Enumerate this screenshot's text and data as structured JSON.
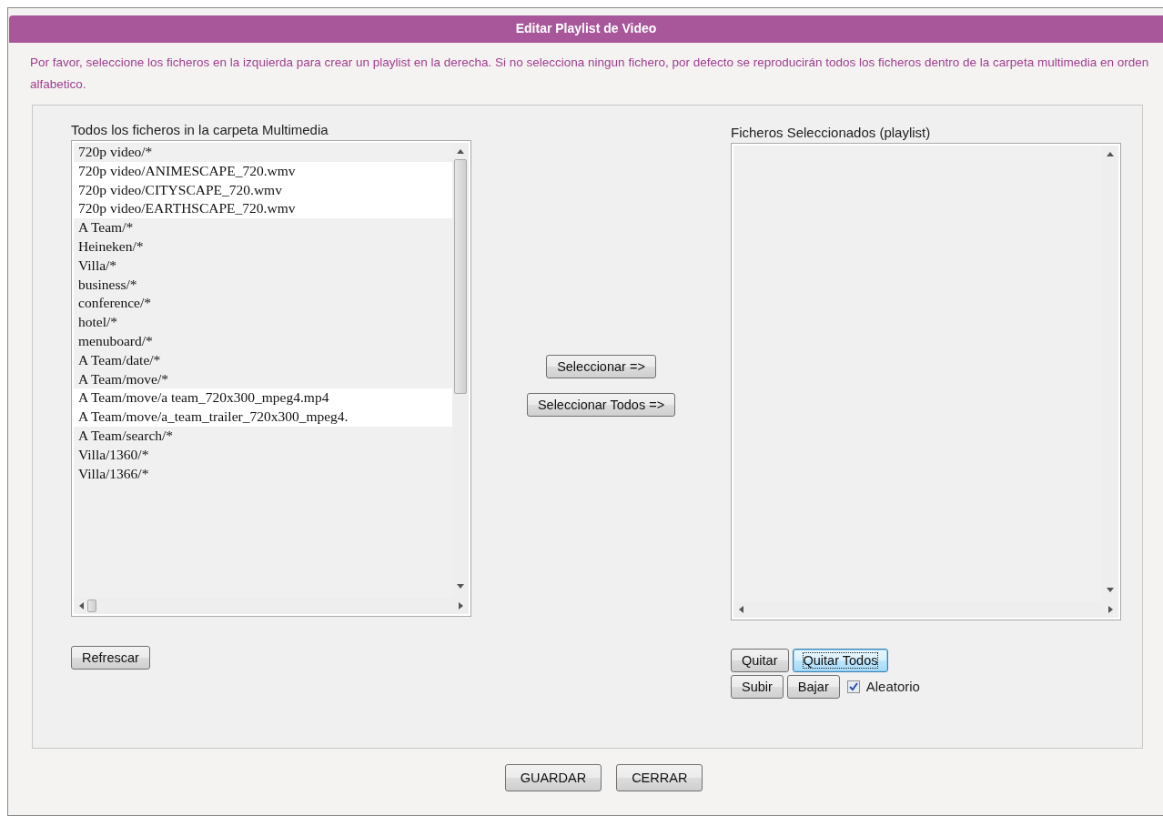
{
  "window": {
    "title": "Editar Playlist de Video"
  },
  "instructions": "Por favor, seleccione los ficheros en la izquierda para crear un playlist en la derecha. Si no selecciona ningun fichero, por defecto se reproducirán todos los ficheros dentro de la carpeta multimedia en orden alfabetico.",
  "all_files": {
    "label": "Todos los ficheros in la carpeta Multimedia",
    "items": [
      {
        "text": "720p video/*",
        "kind": "folder"
      },
      {
        "text": "720p video/ANIMESCAPE_720.wmv",
        "kind": "file"
      },
      {
        "text": "720p video/CITYSCAPE_720.wmv",
        "kind": "file"
      },
      {
        "text": "720p video/EARTHSCAPE_720.wmv",
        "kind": "file"
      },
      {
        "text": "A Team/*",
        "kind": "folder"
      },
      {
        "text": "Heineken/*",
        "kind": "folder"
      },
      {
        "text": "Villa/*",
        "kind": "folder"
      },
      {
        "text": "business/*",
        "kind": "folder"
      },
      {
        "text": "conference/*",
        "kind": "folder"
      },
      {
        "text": "hotel/*",
        "kind": "folder"
      },
      {
        "text": "menuboard/*",
        "kind": "folder"
      },
      {
        "text": "A Team/date/*",
        "kind": "folder"
      },
      {
        "text": "A Team/move/*",
        "kind": "folder"
      },
      {
        "text": "A Team/move/a team_720x300_mpeg4.mp4",
        "kind": "file"
      },
      {
        "text": "A Team/move/a_team_trailer_720x300_mpeg4.",
        "kind": "file"
      },
      {
        "text": "A Team/search/*",
        "kind": "folder"
      },
      {
        "text": "Villa/1360/*",
        "kind": "folder"
      },
      {
        "text": "Villa/1366/*",
        "kind": "folder"
      }
    ],
    "buttons": [
      {
        "label": "Refrescar",
        "focused": false
      }
    ]
  },
  "move_buttons": [
    {
      "label": "Seleccionar =>",
      "focused": false
    },
    {
      "label": "Seleccionar Todos =>",
      "focused": false
    }
  ],
  "playlist": {
    "label": "Ficheros Seleccionados (playlist)",
    "buttons": [
      {
        "label": "Quitar",
        "focused": false
      },
      {
        "label": "Quitar Todos",
        "focused": true
      },
      {
        "label": "Subir",
        "focused": false
      },
      {
        "label": "Bajar",
        "focused": false
      }
    ],
    "shuffle": {
      "label": "Aleatorio",
      "checked": true
    }
  },
  "footer_buttons": [
    {
      "label": "GUARDAR",
      "focused": false
    },
    {
      "label": "CERRAR",
      "focused": false
    }
  ]
}
